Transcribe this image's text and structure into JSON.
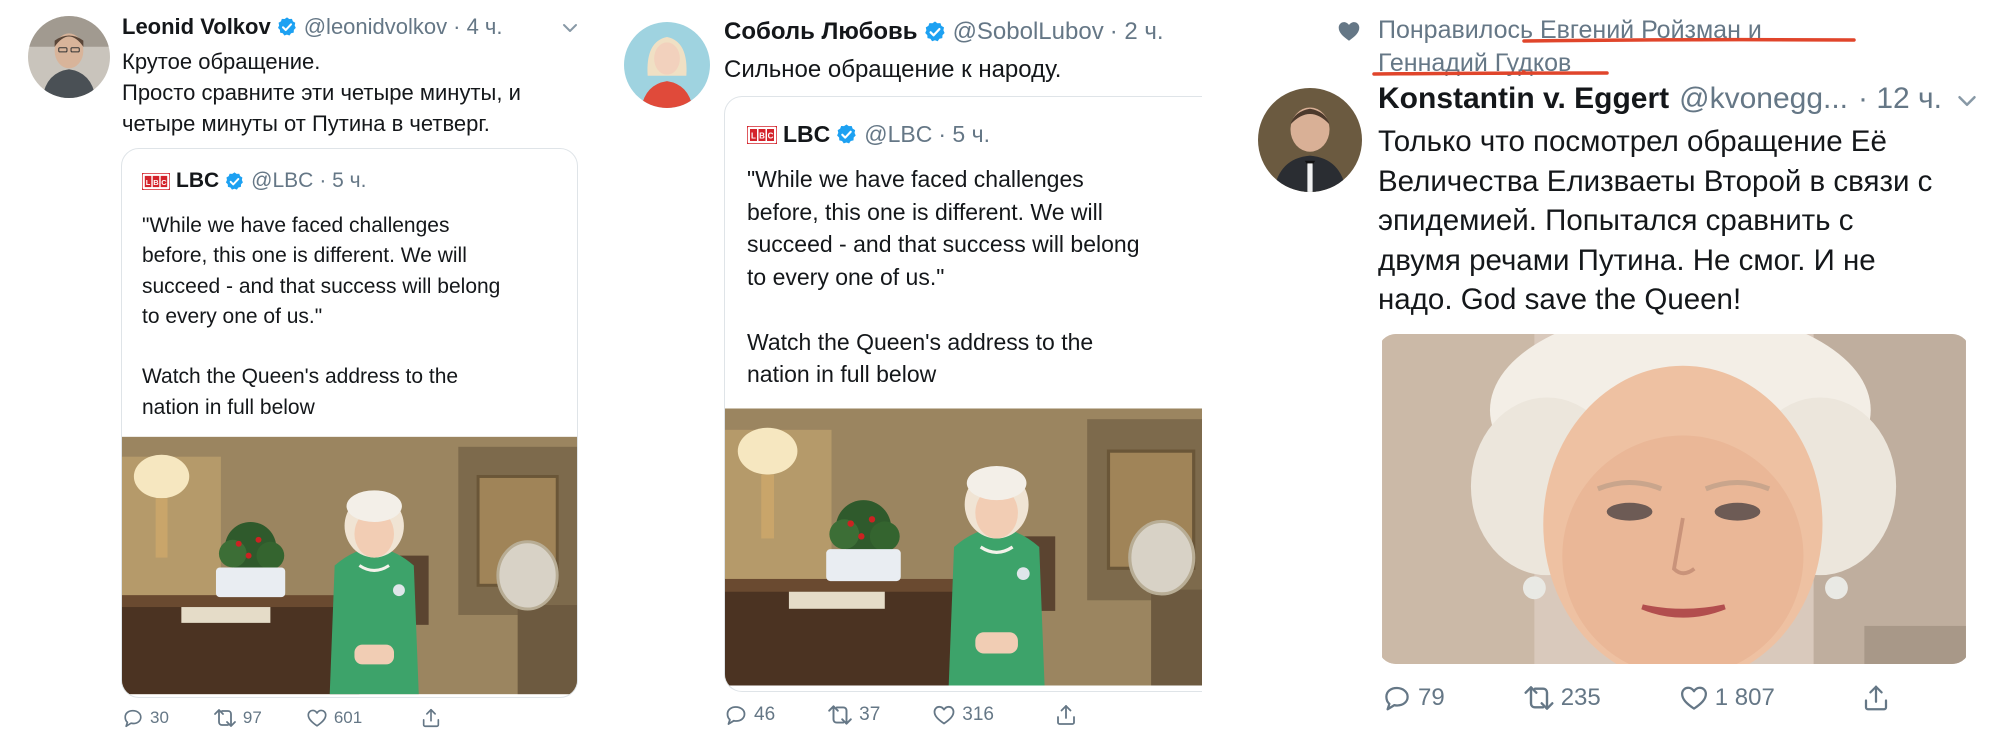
{
  "tweet1": {
    "name": "Leonid Volkov",
    "handle": "@leonidvolkov",
    "time": "· 4 ч.",
    "text": "Крутое обращение.\nПросто сравните эти четыре минуты, и\nчетыре минуты от Путина в четверг.",
    "quote": {
      "name": "LBC",
      "handle": "@LBC",
      "time": "· 5 ч.",
      "text": "\"While we have faced challenges\nbefore, this one is different. We will\nsucceed - and that success will belong\nto every one of us.\"\n\nWatch the Queen's address to the\nnation in full below"
    },
    "replies": "30",
    "retweets": "97",
    "likes": "601"
  },
  "tweet2": {
    "name": "Соболь Любовь",
    "handle": "@SobolLubov",
    "time": "· 2 ч.",
    "text": "Сильное обращение к народу.",
    "quote": {
      "name": "LBC",
      "handle": "@LBC",
      "time": "· 5 ч.",
      "text": "\"While we have faced challenges\nbefore, this one is different. We will\nsucceed - and that success will belong\nto every one of us.\"\n\nWatch the Queen's address to the\nnation in full below"
    },
    "replies": "46",
    "retweets": "37",
    "likes": "316"
  },
  "tweet3": {
    "liked_by": "Понравилось Евгений Ройзман и\nГеннадий Гудков",
    "name": "Konstantin v. Eggert",
    "handle": "@kvonegg...",
    "time": "· 12 ч.",
    "text": "Только что посмотрел обращение Её\nВеличества Елизваеты Второй в связи с\nэпидемией. Попытался сравнить с\nдвумя речами Путина. Не смог. И не\nнадо. God save the Queen!",
    "replies": "79",
    "retweets": "235",
    "likes": "1 807"
  },
  "colors": {
    "verified": "#1da1f2",
    "underline": "#e0452b",
    "muted": "#657786",
    "lbc_red": "#d4232b"
  },
  "icons": [
    "verified-badge-icon",
    "reply-icon",
    "retweet-icon",
    "like-icon",
    "share-icon",
    "chevron-down-icon",
    "heart-icon",
    "lbc-logo-icon"
  ]
}
